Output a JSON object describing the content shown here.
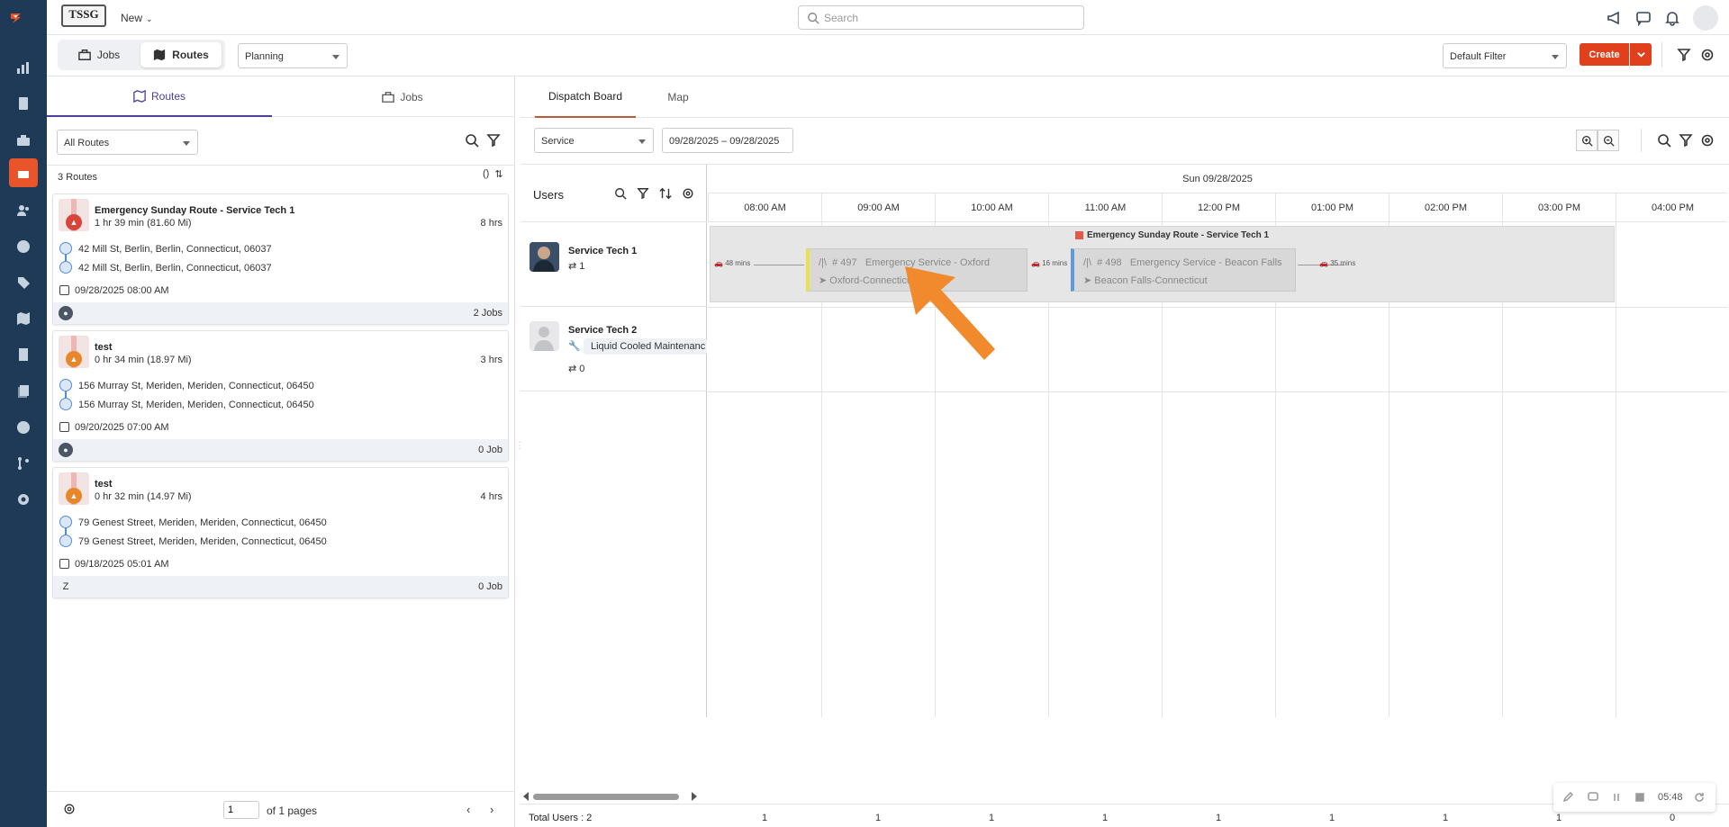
{
  "brand": {
    "text": "TSSG"
  },
  "topbar": {
    "new_label": "New",
    "search_placeholder": "Search"
  },
  "subbar": {
    "view_jobs": "Jobs",
    "view_routes": "Routes",
    "mode_select": "Planning",
    "filter_select": "Default Filter",
    "create_label": "Create"
  },
  "left": {
    "tab_routes": "Routes",
    "tab_jobs": "Jobs",
    "routes_filter": "All Routes",
    "count_label": "3 Routes",
    "sort_hint": "()",
    "routes": [
      {
        "title": "Emergency Sunday Route - Service Tech 1",
        "duration": "1 hr 39 min (81.60 Mi)",
        "hours": "8 hrs",
        "start": "42 Mill St, Berlin, Berlin, Connecticut, 06037",
        "end": "42 Mill St, Berlin, Berlin, Connecticut, 06037",
        "date": "09/28/2025 08:00 AM",
        "jobs": "2 Jobs",
        "avatar": "",
        "marker_color": "#d9453b"
      },
      {
        "title": "test",
        "duration": "0 hr 34 min (18.97 Mi)",
        "hours": "3 hrs",
        "start": "156 Murray St, Meriden, Meriden, Connecticut, 06450",
        "end": "156 Murray St, Meriden, Meriden, Connecticut, 06450",
        "date": "09/20/2025 07:00 AM",
        "jobs": "0 Job",
        "avatar": "",
        "marker_color": "#e8862a"
      },
      {
        "title": "test",
        "duration": "0 hr 32 min (14.97 Mi)",
        "hours": "4 hrs",
        "start": "79 Genest Street, Meriden, Meriden, Connecticut, 06450",
        "end": "79 Genest Street, Meriden, Meriden, Connecticut, 06450",
        "date": "09/18/2025 05:01 AM",
        "jobs": "0 Job",
        "avatar": "Z",
        "marker_color": "#e8862a"
      }
    ],
    "page_value": "1",
    "page_of": "of 1 pages"
  },
  "right": {
    "tab_dispatch": "Dispatch Board",
    "tab_map": "Map",
    "service_select": "Service",
    "date_range": "09/28/2025 – 09/28/2025",
    "users_title": "Users",
    "day_label": "Sun 09/28/2025",
    "hours": [
      "08:00 AM",
      "09:00 AM",
      "10:00 AM",
      "11:00 AM",
      "12:00 PM",
      "01:00 PM",
      "02:00 PM",
      "03:00 PM",
      "04:00 PM"
    ],
    "users": [
      {
        "name": "Service Tech 1",
        "count": "1"
      },
      {
        "name": "Service Tech 2",
        "skill": "Liquid Cooled Maintenanc",
        "count": "0"
      }
    ],
    "route_band_title": "Emergency Sunday Route - Service Tech 1",
    "jobs": [
      {
        "number": "# 497",
        "title": "Emergency Service - Oxford",
        "location": "Oxford-Connecticut",
        "accent": "#e7e24a"
      },
      {
        "number": "# 498",
        "title": "Emergency Service - Beacon Falls",
        "location": "Beacon Falls-Connecticut",
        "accent": "#5b9be0"
      }
    ],
    "drives": [
      "48 mins",
      "16 mins",
      "35 mins"
    ],
    "total_users": "Total Users : 2",
    "totals": [
      "1",
      "1",
      "1",
      "1",
      "1",
      "1",
      "1",
      "1",
      "0"
    ]
  },
  "recorder": {
    "time": "05:48"
  },
  "colors": {
    "accent": "#e0401c",
    "rail": "#1e3a56",
    "arrow": "#f08a2c"
  }
}
